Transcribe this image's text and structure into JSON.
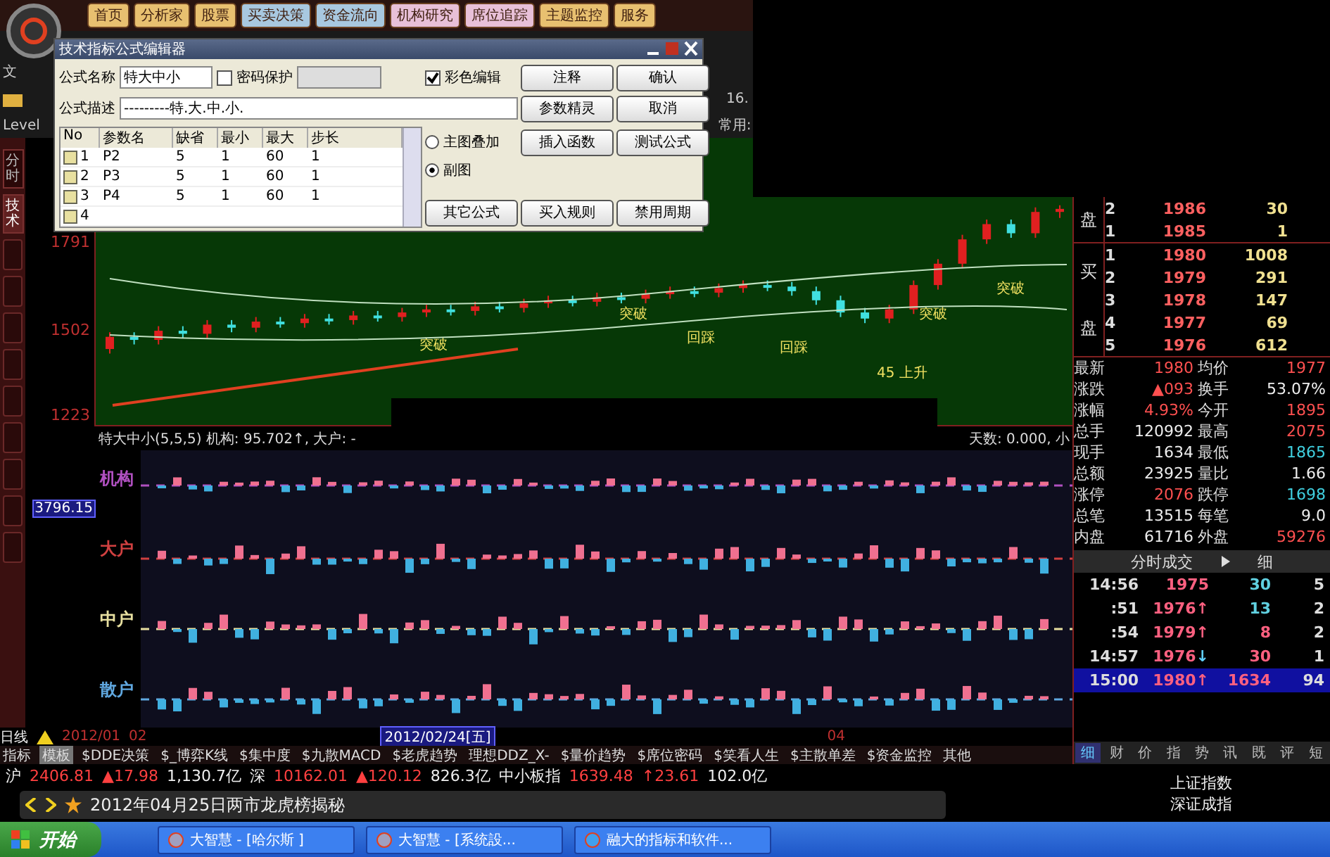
{
  "nav": {
    "items": [
      {
        "label": "首页",
        "color": "#e8c070"
      },
      {
        "label": "分析家",
        "color": "#e8c070"
      },
      {
        "label": "股票",
        "color": "#e8c070"
      },
      {
        "label": "买卖决策",
        "color": "#a8c8e0"
      },
      {
        "label": "资金流向",
        "color": "#a8c8e0"
      },
      {
        "label": "机构研究",
        "color": "#e8c0d8"
      },
      {
        "label": "席位追踪",
        "color": "#e8c0d8"
      },
      {
        "label": "主题监控",
        "color": "#e8c070"
      },
      {
        "label": "服务",
        "color": "#e8c070"
      }
    ]
  },
  "toolbar": {
    "menu": "文",
    "level_label": "Level",
    "common_label": "常用:",
    "value": "16."
  },
  "dialog": {
    "title": "技术指标公式编辑器",
    "name_label": "公式名称",
    "name_value": "特大中小",
    "password": {
      "label": "密码保护",
      "checked": false
    },
    "color_edit": {
      "label": "彩色编辑",
      "checked": true
    },
    "desc_label": "公式描述",
    "desc_value": "---------特.大.中.小.",
    "columns": [
      "No",
      "参数名",
      "缺省",
      "最小",
      "最大",
      "步长"
    ],
    "rows": [
      {
        "cells": [
          "1",
          "P2",
          "5",
          "1",
          "60",
          "1"
        ]
      },
      {
        "cells": [
          "2",
          "P3",
          "5",
          "1",
          "60",
          "1"
        ]
      },
      {
        "cells": [
          "3",
          "P4",
          "5",
          "1",
          "60",
          "1"
        ]
      },
      {
        "cells": [
          "4"
        ]
      }
    ],
    "radios": [
      {
        "label": "主图叠加",
        "selected": false
      },
      {
        "label": "副图",
        "selected": true
      }
    ],
    "buttons": [
      "注释",
      "确认",
      "参数精灵",
      "取消",
      "插入函数",
      "测试公式",
      "其它公式",
      "买入规则",
      "禁用周期"
    ]
  },
  "side_tabs": [
    {
      "label": "分时",
      "selected": false
    },
    {
      "label": "技术",
      "selected": true
    }
  ],
  "axis": {
    "cursor_value": "3796.15"
  },
  "chart": {
    "labels": [
      "突破",
      "回踩",
      "突破",
      "回踩",
      "突破",
      "突破",
      "45 上升"
    ],
    "chart_data": {
      "type": "candlestick",
      "yticks": [
        1223,
        1502,
        1791
      ],
      "ylim": [
        1186,
        2133
      ],
      "ohlc": [
        [
          1440,
          1495,
          1425,
          1480
        ],
        [
          1480,
          1495,
          1455,
          1470
        ],
        [
          1470,
          1515,
          1455,
          1500
        ],
        [
          1500,
          1515,
          1475,
          1490
        ],
        [
          1490,
          1535,
          1475,
          1520
        ],
        [
          1520,
          1535,
          1495,
          1510
        ],
        [
          1510,
          1545,
          1495,
          1530
        ],
        [
          1530,
          1545,
          1510,
          1525
        ],
        [
          1525,
          1555,
          1510,
          1540
        ],
        [
          1540,
          1555,
          1520,
          1535
        ],
        [
          1535,
          1565,
          1520,
          1550
        ],
        [
          1550,
          1565,
          1530,
          1545
        ],
        [
          1545,
          1575,
          1530,
          1560
        ],
        [
          1560,
          1585,
          1545,
          1570
        ],
        [
          1570,
          1585,
          1550,
          1565
        ],
        [
          1565,
          1595,
          1550,
          1580
        ],
        [
          1580,
          1595,
          1560,
          1575
        ],
        [
          1575,
          1605,
          1560,
          1590
        ],
        [
          1590,
          1615,
          1575,
          1600
        ],
        [
          1600,
          1615,
          1580,
          1595
        ],
        [
          1595,
          1625,
          1580,
          1610
        ],
        [
          1610,
          1625,
          1590,
          1605
        ],
        [
          1605,
          1635,
          1590,
          1620
        ],
        [
          1620,
          1645,
          1605,
          1630
        ],
        [
          1630,
          1645,
          1610,
          1625
        ],
        [
          1625,
          1655,
          1610,
          1640
        ],
        [
          1640,
          1665,
          1625,
          1650
        ],
        [
          1650,
          1665,
          1630,
          1645
        ],
        [
          1645,
          1660,
          1615,
          1630
        ],
        [
          1630,
          1645,
          1585,
          1600
        ],
        [
          1600,
          1615,
          1545,
          1560
        ],
        [
          1560,
          1575,
          1525,
          1540
        ],
        [
          1540,
          1585,
          1525,
          1570
        ],
        [
          1570,
          1665,
          1555,
          1650
        ],
        [
          1650,
          1735,
          1635,
          1720
        ],
        [
          1720,
          1815,
          1705,
          1800
        ],
        [
          1800,
          1865,
          1785,
          1850
        ],
        [
          1850,
          1865,
          1805,
          1820
        ],
        [
          1820,
          1905,
          1805,
          1890
        ],
        [
          1890,
          1912,
          1870,
          1900
        ]
      ]
    }
  },
  "indicator": {
    "header": "特大中小(5,5,5)  机构: 95.702↑, 大户: -",
    "header_right": "天数: 0.000, 小",
    "rows": [
      {
        "label": "机构",
        "color": "#b050c0"
      },
      {
        "label": "大户",
        "color": "#d04040"
      },
      {
        "label": "中户",
        "color": "#e8e0a0"
      },
      {
        "label": "散户",
        "color": "#60a8e0"
      }
    ]
  },
  "orderbook": {
    "sell_label": "盘",
    "sell": [
      {
        "no": "2",
        "price": "1986",
        "volume": "30"
      },
      {
        "no": "1",
        "price": "1985",
        "volume": "1"
      }
    ],
    "buy_label_top": "买",
    "buy_label_bottom": "盘",
    "buy": [
      {
        "no": "1",
        "price": "1980",
        "volume": "1008"
      },
      {
        "no": "2",
        "price": "1979",
        "volume": "291"
      },
      {
        "no": "3",
        "price": "1978",
        "volume": "147"
      },
      {
        "no": "4",
        "price": "1977",
        "volume": "69"
      },
      {
        "no": "5",
        "price": "1976",
        "volume": "612"
      }
    ]
  },
  "stats": [
    [
      {
        "label": "最新",
        "value": "1980",
        "color": "#ff5050"
      },
      {
        "label": "均价",
        "value": "1977",
        "color": "#ff5050"
      }
    ],
    [
      {
        "label": "涨跌",
        "value": "▲093",
        "color": "#ff5050"
      },
      {
        "label": "换手",
        "value": "53.07%",
        "color": "#eeeeee"
      }
    ],
    [
      {
        "label": "涨幅",
        "value": "4.93%",
        "color": "#ff5050"
      },
      {
        "label": "今开",
        "value": "1895",
        "color": "#ff5050"
      }
    ],
    [
      {
        "label": "总手",
        "value": "120992",
        "color": "#eeeeee"
      },
      {
        "label": "最高",
        "value": "2075",
        "color": "#ff5050"
      }
    ],
    [
      {
        "label": "现手",
        "value": "1634",
        "color": "#eeeeee"
      },
      {
        "label": "最低",
        "value": "1865",
        "color": "#40d0e0"
      }
    ],
    [
      {
        "label": "总额",
        "value": "23925",
        "color": "#eeeeee"
      },
      {
        "label": "量比",
        "value": "1.66",
        "color": "#eeeeee"
      }
    ],
    [
      {
        "label": "涨停",
        "value": "2076",
        "color": "#ff5050"
      },
      {
        "label": "跌停",
        "value": "1698",
        "color": "#40d0e0"
      }
    ],
    [
      {
        "label": "总笔",
        "value": "13515",
        "color": "#eeeeee"
      },
      {
        "label": "每笔",
        "value": "9.0",
        "color": "#eeeeee"
      }
    ],
    [
      {
        "label": "内盘",
        "value": "61716",
        "color": "#eeeeee"
      },
      {
        "label": "外盘",
        "value": "59276",
        "color": "#ff5050"
      }
    ]
  ],
  "ticks": {
    "title": "分时成交",
    "detail": "细",
    "rows": [
      {
        "time": "14:56",
        "price": "1975",
        "volume": {
          "text": "30",
          "color": "#60d0e0"
        },
        "count": "5",
        "selected": false
      },
      {
        "time": ":51",
        "price": "1976",
        "arrow": {
          "text": "↑",
          "color": "#ff6080"
        },
        "volume": {
          "text": "13",
          "color": "#60d0e0"
        },
        "count": "2",
        "selected": false
      },
      {
        "time": ":54",
        "price": "1979",
        "arrow": {
          "text": "↑",
          "color": "#ff6080"
        },
        "volume": {
          "text": "8",
          "color": "#ff6080"
        },
        "count": "2",
        "selected": false
      },
      {
        "time": "14:57",
        "price": "1976",
        "arrow": {
          "text": "↓",
          "color": "#60d0ff"
        },
        "volume": {
          "text": "30",
          "color": "#ff6080"
        },
        "count": "1",
        "selected": false
      },
      {
        "time": "15:00",
        "price": "1980",
        "arrow": {
          "text": "↑",
          "color": "#ff6080"
        },
        "volume": {
          "text": "1634",
          "color": "#ff6080"
        },
        "count": "94",
        "selected": true
      }
    ]
  },
  "right_tabs": [
    {
      "label": "细",
      "selected": true
    },
    {
      "label": "财",
      "selected": false
    },
    {
      "label": "价",
      "selected": false
    },
    {
      "label": "指",
      "selected": false
    },
    {
      "label": "势",
      "selected": false
    },
    {
      "label": "讯",
      "selected": false
    },
    {
      "label": "既",
      "selected": false
    },
    {
      "label": "评",
      "selected": false
    },
    {
      "label": "短",
      "selected": false
    }
  ],
  "date_bar": {
    "period": "日线",
    "marks": [
      "2012/01",
      "02"
    ],
    "cursor_date": "2012/02/24[五]",
    "end_mark": "04"
  },
  "formula_tabs": [
    {
      "label": "指标",
      "selected": false
    },
    {
      "label": "模板",
      "selected": true
    },
    {
      "label": "$DDE决策",
      "selected": false
    },
    {
      "label": "$_博弈K线",
      "selected": false
    },
    {
      "label": "$集中度",
      "selected": false
    },
    {
      "label": "$九散MACD",
      "selected": false
    },
    {
      "label": "$老虎趋势",
      "selected": false
    },
    {
      "label": "理想DDZ_X-",
      "selected": false
    },
    {
      "label": "$量价趋势",
      "selected": false
    },
    {
      "label": "$席位密码",
      "selected": false
    },
    {
      "label": "$笑看人生",
      "selected": false
    },
    {
      "label": "$主散单差",
      "selected": false
    },
    {
      "label": "$资金监控",
      "selected": false
    },
    {
      "label": "其他",
      "selected": false
    }
  ],
  "index_bar": [
    {
      "market": "沪",
      "value": "2406.81",
      "change": "▲17.98",
      "amount": "1,130.7亿"
    },
    {
      "market": "深",
      "value": "10162.01",
      "change": "▲120.12",
      "amount": "826.3亿"
    },
    {
      "market": "中小板指",
      "value": "1639.48",
      "change": "↑23.61",
      "amount": "102.0亿"
    }
  ],
  "index_links": [
    "上证指数",
    "深证成指"
  ],
  "news": {
    "text": "2012年04月25日两市龙虎榜揭秘"
  },
  "taskbar": {
    "start": "开始",
    "tasks": [
      "大智慧 - [哈尔斯 ]",
      "大智慧 - [系统設...",
      "融大的指标和软件..."
    ]
  }
}
